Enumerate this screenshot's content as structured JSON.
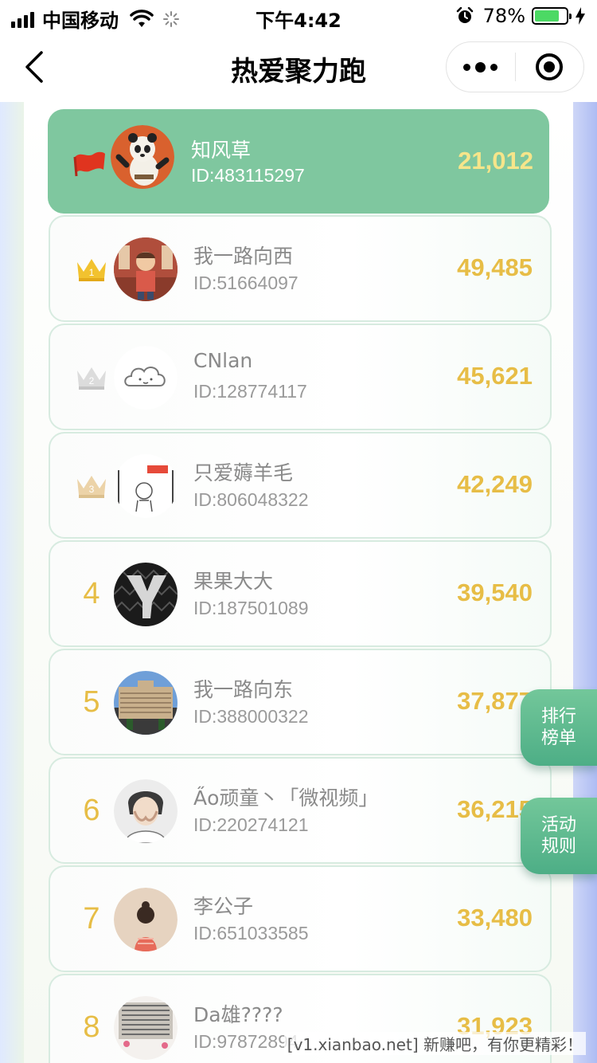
{
  "status_bar": {
    "carrier": "中国移动",
    "time": "下午4:42",
    "battery_percent": "78%",
    "battery_level": 0.78,
    "battery_color": "#4cd964"
  },
  "nav": {
    "title": "热爱聚力跑"
  },
  "colors": {
    "accent_green": "#7fc79f",
    "score_gold": "#e7bd46"
  },
  "me": {
    "name": "知风草",
    "id": "ID:483115297",
    "score": "21,012",
    "rank_icon": "red-flag-icon"
  },
  "ranking": [
    {
      "rank": "1",
      "rank_icon": "gold-crown-icon",
      "name": "我一路向西",
      "id": "ID:51664097",
      "score": "49,485"
    },
    {
      "rank": "2",
      "rank_icon": "silver-crown-icon",
      "name": "CNlan",
      "id": "ID:128774117",
      "score": "45,621"
    },
    {
      "rank": "3",
      "rank_icon": "bronze-crown-icon",
      "name": "只爱薅羊毛",
      "id": "ID:806048322",
      "score": "42,249"
    },
    {
      "rank": "4",
      "name": "果果大大",
      "id": "ID:187501089",
      "score": "39,540"
    },
    {
      "rank": "5",
      "name": "我一路向东",
      "id": "ID:388000322",
      "score": "37,877"
    },
    {
      "rank": "6",
      "name": "A̋o顽童丶「微视频」",
      "id": "ID:220274121",
      "score": "36,215"
    },
    {
      "rank": "7",
      "name": "李公子",
      "id": "ID:651033585",
      "score": "33,480"
    },
    {
      "rank": "8",
      "name": "Da雄????",
      "id": "ID:97872894",
      "score": "31,923"
    }
  ],
  "side_buttons": {
    "leaderboard_line1": "排行",
    "leaderboard_line2": "榜单",
    "rules_line1": "活动",
    "rules_line2": "规则"
  },
  "watermark": "[v1.xianbao.net] 新赚吧，有你更精彩！"
}
